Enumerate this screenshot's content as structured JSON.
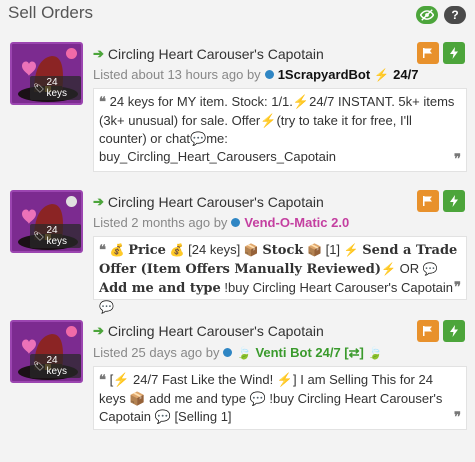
{
  "panel": {
    "title": "Sell Orders",
    "help_label": "?"
  },
  "colors": {
    "accent_green": "#4ca53b",
    "flag_orange": "#e8912c",
    "unusual_purple": "#7c2b90"
  },
  "orders": [
    {
      "item_name": "Circling Heart Carouser's Capotain",
      "price_badge": "24 keys",
      "listed_text": "Listed about 13 hours ago by",
      "username": "1ScrapyardBot",
      "username_suffix": "24/7",
      "username_color": "#111111",
      "status_dot_color": "#2f86c4",
      "quality_dot_color": "#f06aa8",
      "message_lines": [
        "24 keys for MY item. Stock: 1/1.⚡24/7 INSTANT. 5k+ items",
        "(3k+ unusual) for sale. Offer⚡(try to take it for free, I'll",
        "counter) or chat💬me:",
        "buy_Circling_Heart_Carousers_Capotain"
      ]
    },
    {
      "item_name": "Circling Heart Carouser's Capotain",
      "price_badge": "24 keys",
      "listed_text": "Listed 2 months ago by",
      "username": "Vend-O-Matic 2.0",
      "username_color": "#c43fa0",
      "status_dot_color": "#2f86c4",
      "quality_dot_color": "#e0e0e0",
      "message": {
        "price_label": "Price",
        "price_value": "[24 keys]",
        "stock_label": "Stock",
        "stock_value": "[1]",
        "send_label": "Send a Trade Offer (Item Offers Manually Reviewed)",
        "or_text": "OR",
        "add_label": "Add me and type",
        "command": "!buy Circling Heart Carouser's Capotain"
      }
    },
    {
      "item_name": "Circling Heart Carouser's Capotain",
      "price_badge": "24 keys",
      "listed_text": "Listed 25 days ago by",
      "username": "Venti Bot 24/7 [⇄]",
      "username_color": "#3a9a2c",
      "status_dot_color": "#2f86c4",
      "quality_dot_color": "#f06aa8",
      "message_lines": [
        "[⚡ 24/7 Fast Like the Wind! ⚡] I am Selling This for 24",
        "keys 📦 add me and type 💬 !buy Circling Heart Carouser's",
        "Capotain 💬 [Selling 1]"
      ]
    }
  ]
}
